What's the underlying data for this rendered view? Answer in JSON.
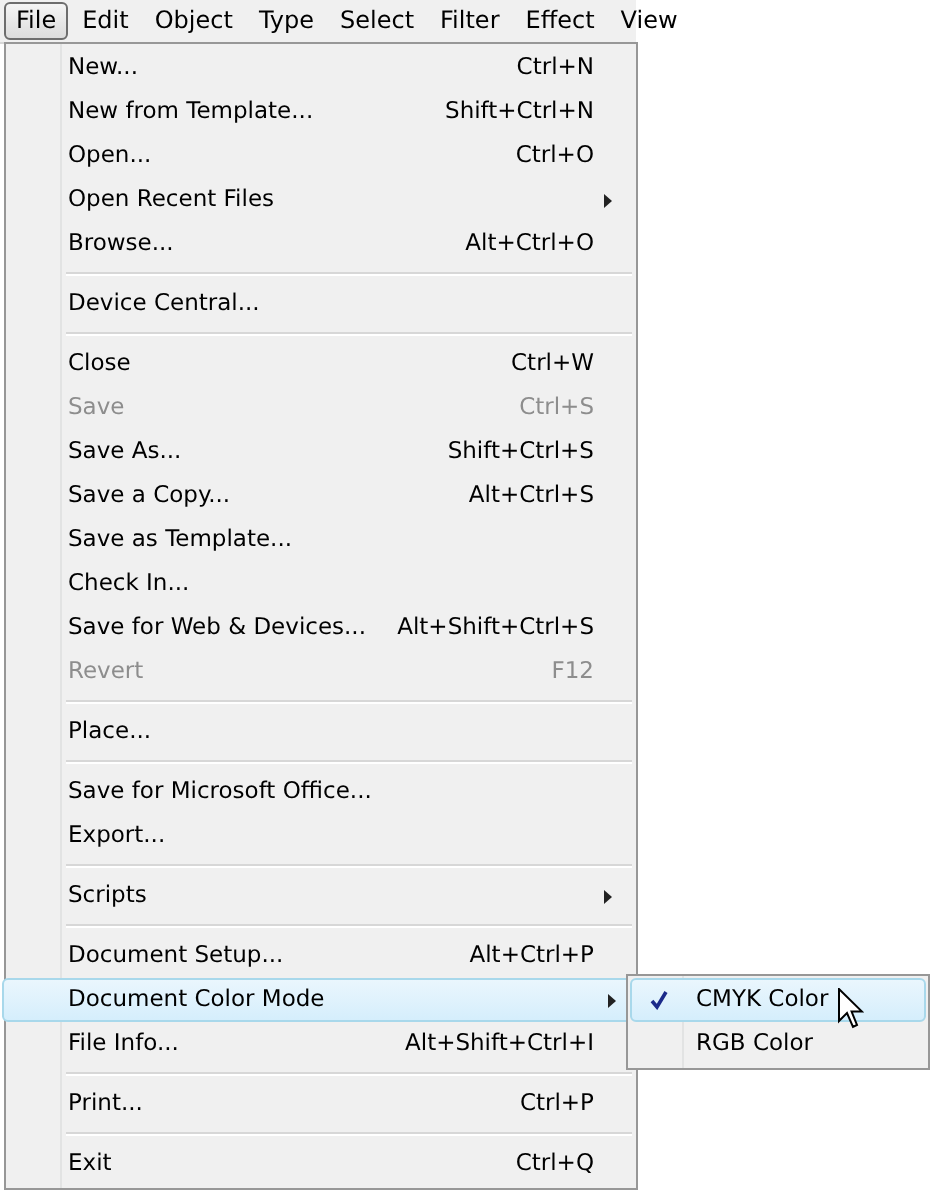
{
  "menu_bar": [
    {
      "label": "File",
      "selected": true
    },
    {
      "label": "Edit",
      "selected": false
    },
    {
      "label": "Object",
      "selected": false
    },
    {
      "label": "Type",
      "selected": false
    },
    {
      "label": "Select",
      "selected": false
    },
    {
      "label": "Filter",
      "selected": false
    },
    {
      "label": "Effect",
      "selected": false
    },
    {
      "label": "View",
      "selected": false
    }
  ],
  "file_menu": [
    {
      "kind": "item",
      "label": "New...",
      "shortcut": "Ctrl+N",
      "disabled": false,
      "submenu": false,
      "selected": false
    },
    {
      "kind": "item",
      "label": "New from Template...",
      "shortcut": "Shift+Ctrl+N",
      "disabled": false,
      "submenu": false,
      "selected": false
    },
    {
      "kind": "item",
      "label": "Open...",
      "shortcut": "Ctrl+O",
      "disabled": false,
      "submenu": false,
      "selected": false
    },
    {
      "kind": "item",
      "label": "Open Recent Files",
      "disabled": false,
      "submenu": true,
      "selected": false
    },
    {
      "kind": "item",
      "label": "Browse...",
      "shortcut": "Alt+Ctrl+O",
      "disabled": false,
      "submenu": false,
      "selected": false
    },
    {
      "kind": "separator"
    },
    {
      "kind": "item",
      "label": "Device Central...",
      "disabled": false,
      "submenu": false,
      "selected": false
    },
    {
      "kind": "separator"
    },
    {
      "kind": "item",
      "label": "Close",
      "shortcut": "Ctrl+W",
      "disabled": false,
      "submenu": false,
      "selected": false
    },
    {
      "kind": "item",
      "label": "Save",
      "shortcut": "Ctrl+S",
      "disabled": true,
      "submenu": false,
      "selected": false
    },
    {
      "kind": "item",
      "label": "Save As...",
      "shortcut": "Shift+Ctrl+S",
      "disabled": false,
      "submenu": false,
      "selected": false
    },
    {
      "kind": "item",
      "label": "Save a Copy...",
      "shortcut": "Alt+Ctrl+S",
      "disabled": false,
      "submenu": false,
      "selected": false
    },
    {
      "kind": "item",
      "label": "Save as Template...",
      "disabled": false,
      "submenu": false,
      "selected": false
    },
    {
      "kind": "item",
      "label": "Check In...",
      "disabled": false,
      "submenu": false,
      "selected": false
    },
    {
      "kind": "item",
      "label": "Save for Web & Devices...",
      "shortcut": "Alt+Shift+Ctrl+S",
      "disabled": false,
      "submenu": false,
      "selected": false
    },
    {
      "kind": "item",
      "label": "Revert",
      "shortcut": "F12",
      "disabled": true,
      "submenu": false,
      "selected": false
    },
    {
      "kind": "separator"
    },
    {
      "kind": "item",
      "label": "Place...",
      "disabled": false,
      "submenu": false,
      "selected": false
    },
    {
      "kind": "separator"
    },
    {
      "kind": "item",
      "label": "Save for Microsoft Office...",
      "disabled": false,
      "submenu": false,
      "selected": false
    },
    {
      "kind": "item",
      "label": "Export...",
      "disabled": false,
      "submenu": false,
      "selected": false
    },
    {
      "kind": "separator"
    },
    {
      "kind": "item",
      "label": "Scripts",
      "disabled": false,
      "submenu": true,
      "selected": false
    },
    {
      "kind": "separator"
    },
    {
      "kind": "item",
      "label": "Document Setup...",
      "shortcut": "Alt+Ctrl+P",
      "disabled": false,
      "submenu": false,
      "selected": false
    },
    {
      "kind": "item",
      "label": "Document Color Mode",
      "disabled": false,
      "submenu": true,
      "selected": true
    },
    {
      "kind": "item",
      "label": "File Info...",
      "shortcut": "Alt+Shift+Ctrl+I",
      "disabled": false,
      "submenu": false,
      "selected": false
    },
    {
      "kind": "separator"
    },
    {
      "kind": "item",
      "label": "Print...",
      "shortcut": "Ctrl+P",
      "disabled": false,
      "submenu": false,
      "selected": false
    },
    {
      "kind": "separator"
    },
    {
      "kind": "item",
      "label": "Exit",
      "shortcut": "Ctrl+Q",
      "disabled": false,
      "submenu": false,
      "selected": false
    }
  ],
  "color_mode_submenu": [
    {
      "label": "CMYK Color",
      "checked": true,
      "selected": true
    },
    {
      "label": "RGB Color",
      "checked": false,
      "selected": false
    }
  ]
}
